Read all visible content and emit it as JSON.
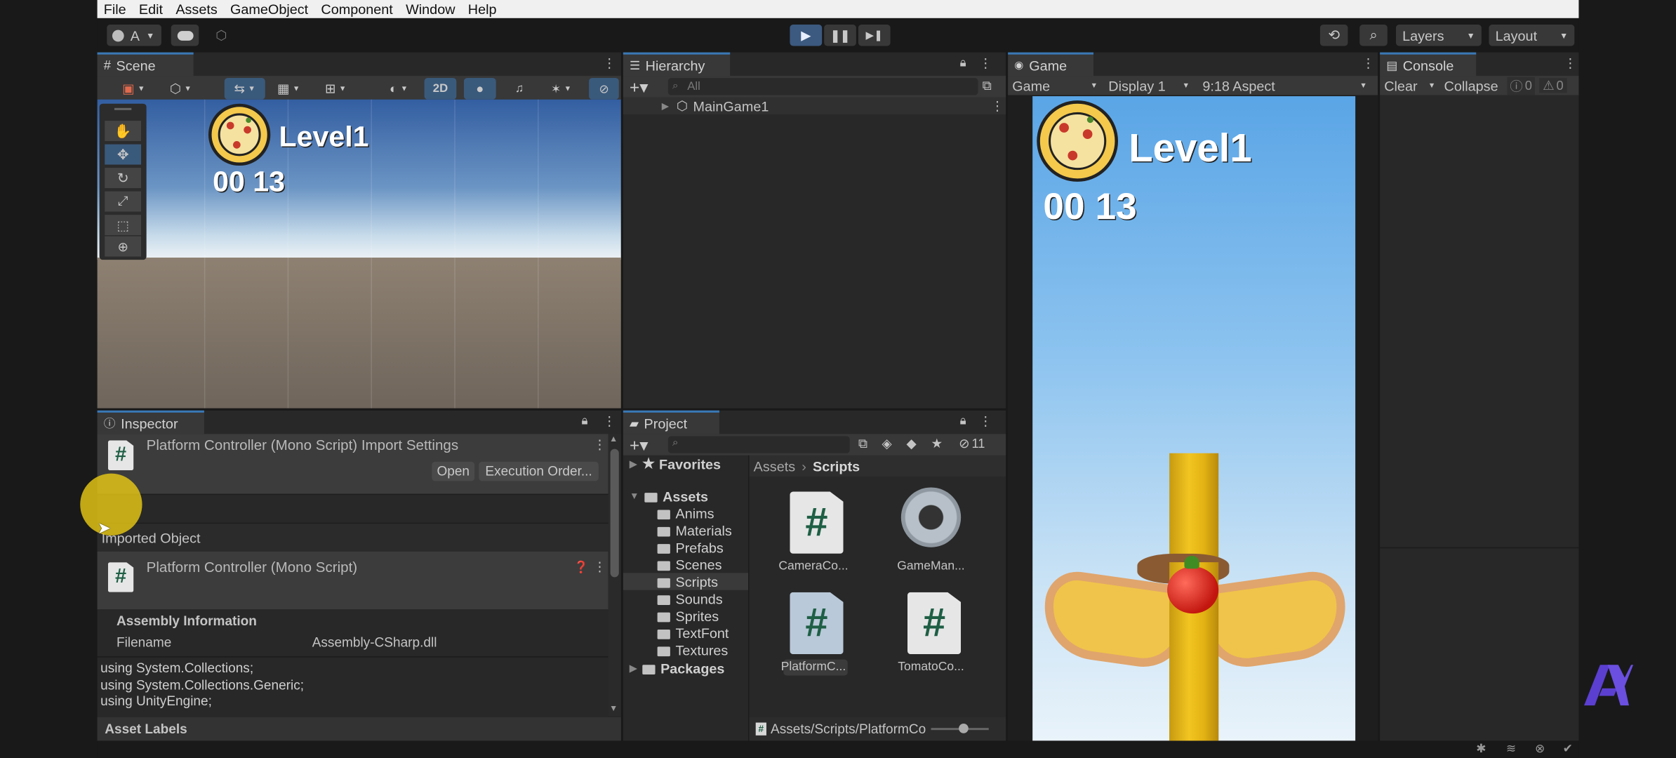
{
  "menu": [
    "File",
    "Edit",
    "Assets",
    "GameObject",
    "Component",
    "Window",
    "Help"
  ],
  "toolbar": {
    "account_label": "A",
    "layers_label": "Layers",
    "layout_label": "Layout"
  },
  "scene": {
    "tab_label": "Scene",
    "mode_2d": "2D",
    "level_text": "Level1",
    "timer_text": "00 13"
  },
  "hierarchy": {
    "tab_label": "Hierarchy",
    "search_placeholder": "All",
    "root_item": "MainGame1"
  },
  "game": {
    "tab_label": "Game",
    "view_select": "Game",
    "display_select": "Display 1",
    "aspect_select": "9:18 Aspect",
    "level_text": "Level1",
    "timer_text": "00 13"
  },
  "console": {
    "tab_label": "Console",
    "clear_label": "Clear",
    "collapse_label": "Collapse",
    "info_count": "0",
    "warn_count": "0"
  },
  "inspector": {
    "tab_label": "Inspector",
    "header_title": "Platform Controller (Mono Script) Import Settings",
    "open_button": "Open",
    "exec_order_button": "Execution Order...",
    "imported_object_label": "Imported Object",
    "script_title": "Platform Controller (Mono Script)",
    "assembly_info_label": "Assembly Information",
    "filename_label": "Filename",
    "filename_value": "Assembly-CSharp.dll",
    "code_lines": [
      "using System.Collections;",
      "using System.Collections.Generic;",
      "using UnityEngine;"
    ],
    "asset_labels": "Asset Labels"
  },
  "project": {
    "tab_label": "Project",
    "hidden_count": "11",
    "favorites_label": "Favorites",
    "assets_label": "Assets",
    "folders": [
      "Anims",
      "Materials",
      "Prefabs",
      "Scenes",
      "Scripts",
      "Sounds",
      "Sprites",
      "TextFont",
      "Textures"
    ],
    "packages_label": "Packages",
    "breadcrumb": [
      "Assets",
      "Scripts"
    ],
    "files": [
      "CameraCo...",
      "GameMan...",
      "PlatformC...",
      "TomatoCo..."
    ],
    "path_text": "Assets/Scripts/PlatformCo"
  },
  "colors": {
    "accent": "#3a78b5",
    "play_active": "#3c5a80",
    "menubar": "#f0f0f0",
    "panel": "#282828"
  }
}
